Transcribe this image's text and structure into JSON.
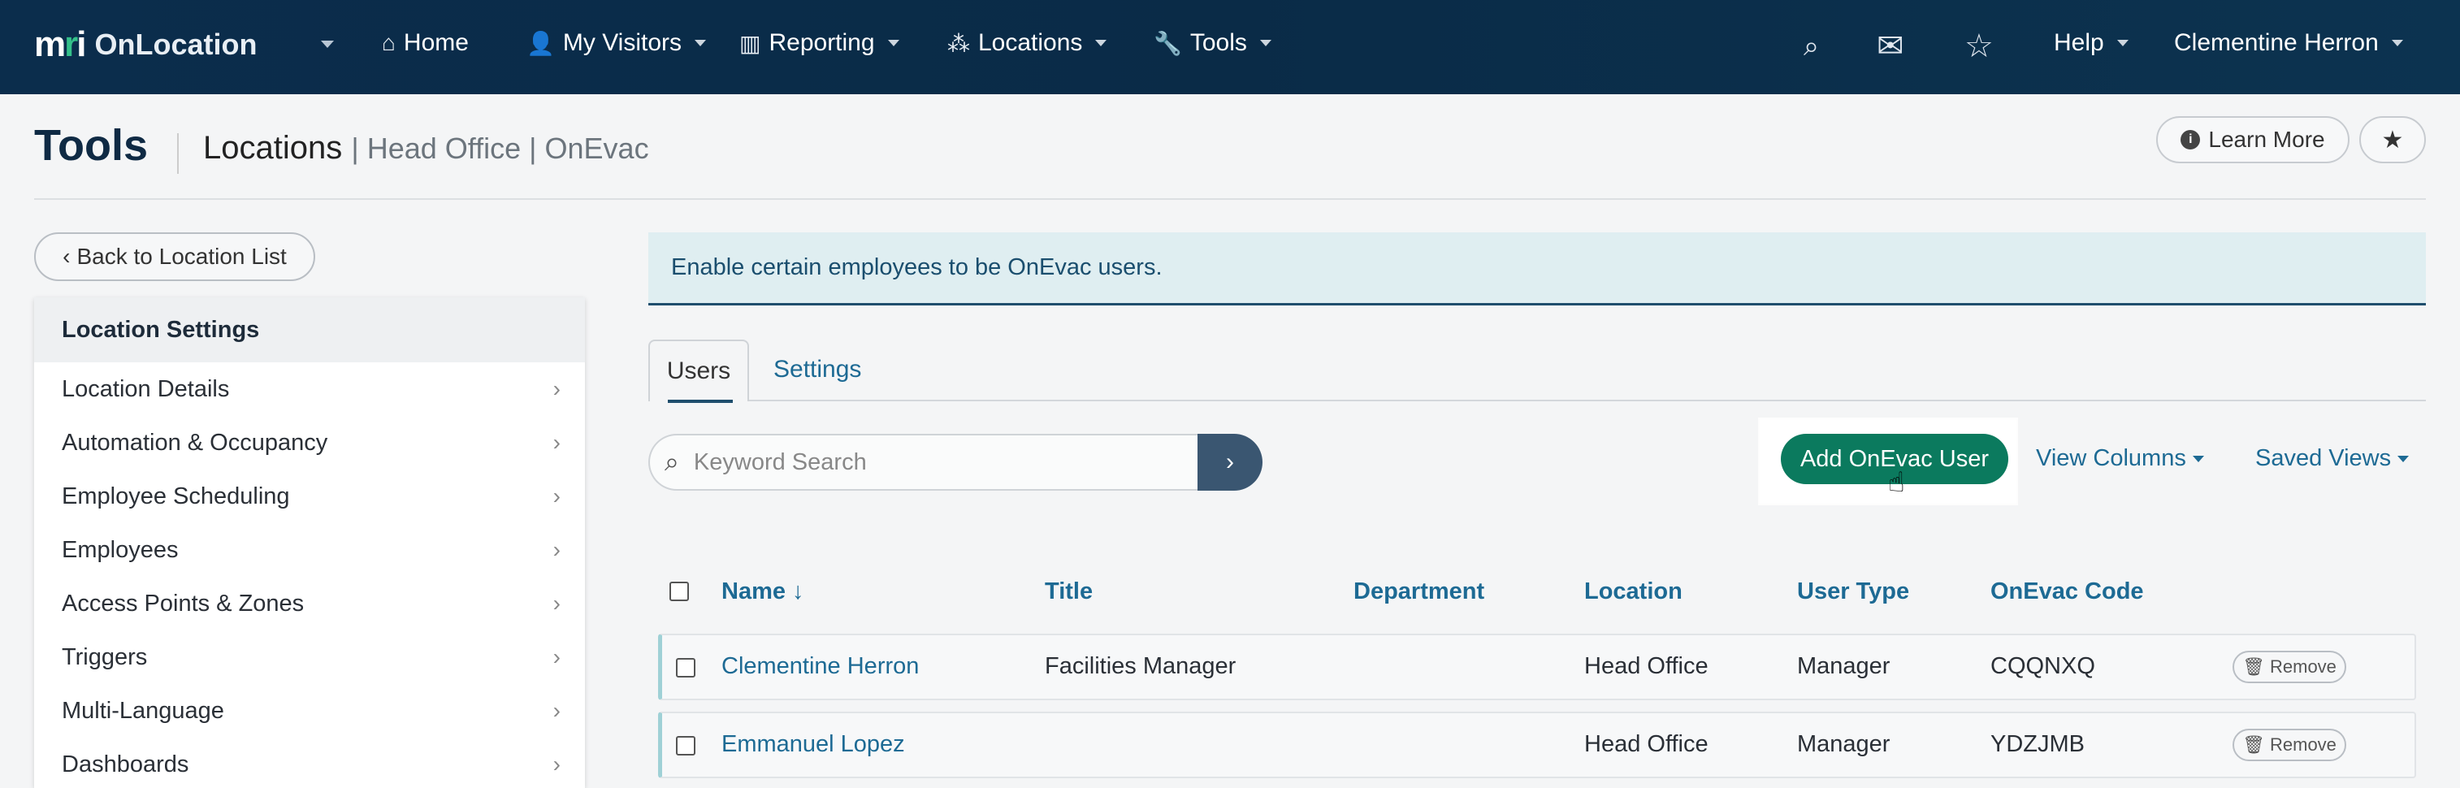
{
  "brand": {
    "logo_text": "mri",
    "app_name": "OnLocation"
  },
  "nav": {
    "items": [
      {
        "label": "Home",
        "icon": "home-icon"
      },
      {
        "label": "My Visitors",
        "icon": "user-icon"
      },
      {
        "label": "Reporting",
        "icon": "chart-icon"
      },
      {
        "label": "Locations",
        "icon": "network-icon"
      },
      {
        "label": "Tools",
        "icon": "wrench-icon"
      }
    ],
    "help_label": "Help",
    "user_label": "Clementine Herron"
  },
  "header": {
    "title": "Tools",
    "breadcrumb_main": "Locations",
    "breadcrumb_sub": "| Head Office | OnEvac",
    "learn_more_label": "Learn More"
  },
  "sidebar": {
    "back_label": "Back to Location List",
    "heading": "Location Settings",
    "items": [
      "Location Details",
      "Automation & Occupancy",
      "Employee Scheduling",
      "Employees",
      "Access Points & Zones",
      "Triggers",
      "Multi-Language",
      "Dashboards"
    ]
  },
  "main": {
    "alert_text": "Enable certain employees to be OnEvac users.",
    "tabs": [
      "Users",
      "Settings"
    ],
    "search_placeholder": "Keyword Search",
    "add_button_label": "Add OnEvac User",
    "view_columns_label": "View Columns",
    "saved_views_label": "Saved Views",
    "columns": {
      "name": "Name ↓",
      "title": "Title",
      "department": "Department",
      "location": "Location",
      "user_type": "User Type",
      "code": "OnEvac Code"
    },
    "rows": [
      {
        "name": "Clementine Herron",
        "title": "Facilities Manager",
        "department": "",
        "location": "Head Office",
        "user_type": "Manager",
        "code": "CQQNXQ",
        "action": "Remove"
      },
      {
        "name": "Emmanuel Lopez",
        "title": "",
        "department": "",
        "location": "Head Office",
        "user_type": "Manager",
        "code": "YDZJMB",
        "action": "Remove"
      }
    ]
  }
}
